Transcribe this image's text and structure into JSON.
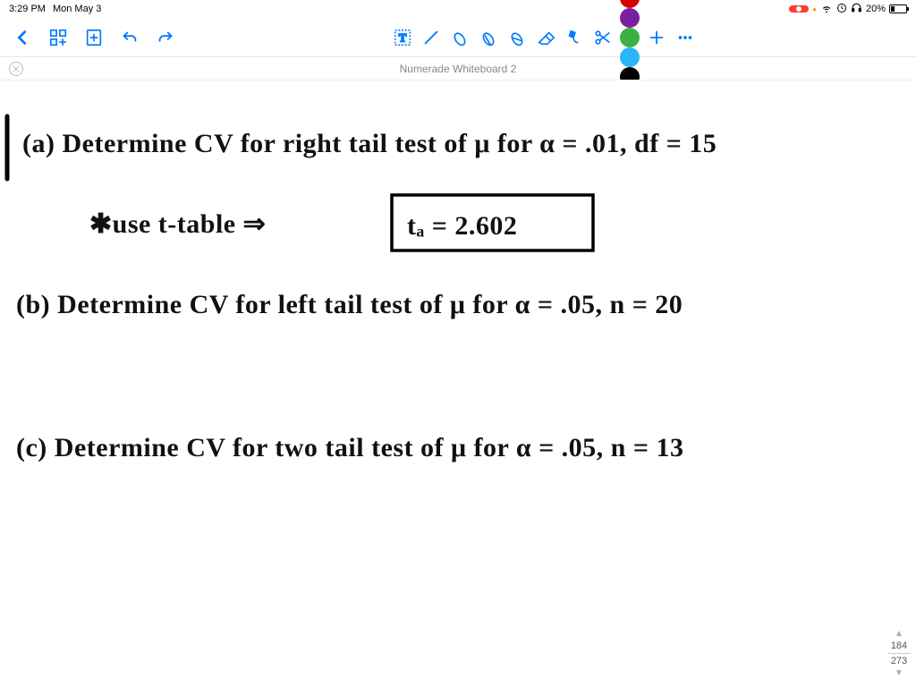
{
  "status": {
    "time": "3:29 PM",
    "date": "Mon May 3",
    "battery_pct": "20%"
  },
  "toolbar": {
    "colors": [
      "#d40000",
      "#7b1fa2",
      "#3cb043",
      "#29b6f6",
      "#000000"
    ]
  },
  "document": {
    "title": "Numerade Whiteboard 2"
  },
  "pages": {
    "current": "184",
    "total": "273"
  },
  "handwriting": {
    "line_a": "(a) Determine CV for right tail test of μ for α = .01, df = 15",
    "line_a2_pre": "✱use t-table ⇒",
    "line_a2_box": "tₐ = 2.602",
    "line_b": "(b) Determine CV for left tail test of μ for α = .05, n = 20",
    "line_c": "(c) Determine CV for two tail test of μ for α = .05, n = 13"
  }
}
